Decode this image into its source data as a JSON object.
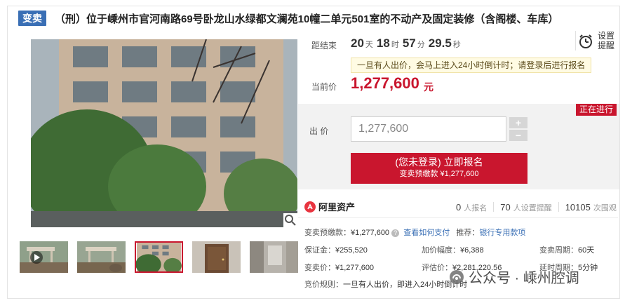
{
  "header": {
    "tag": "变卖",
    "title": "（刑）位于嵊州市官河南路69号卧龙山水绿都文澜苑10幢二单元501室的不动产及固定装修（含阁楼、车库）"
  },
  "countdown": {
    "label": "距结束",
    "days": "20",
    "days_unit": "天",
    "hours": "18",
    "hours_unit": "时",
    "minutes": "57",
    "minutes_unit": "分",
    "seconds": "29.5",
    "seconds_unit": "秒",
    "remind_label": "设置提醒"
  },
  "notice": "一旦有人出价，会马上进入24小时倒计时；请登录后进行报名",
  "current": {
    "label": "当前价",
    "price": "1,277,600",
    "unit": "元"
  },
  "bid": {
    "status": "正在进行",
    "label": "出 价",
    "value": "1,277,600",
    "plus": "+",
    "minus": "−",
    "button_main": "(您未登录) 立即报名",
    "button_sub": "变卖预缴款 ¥1,277,600"
  },
  "platform": {
    "name": "阿里资产",
    "signups": "0",
    "signups_label": "人报名",
    "reminders": "70",
    "reminders_label": "人设置提醒",
    "views": "10105",
    "views_label": "次围观"
  },
  "info": {
    "deposit_label": "变卖预缴款：",
    "deposit_value": "¥1,277,600",
    "pay_link": "查看如何支付",
    "recommend_label": "推荐：",
    "recommend_link": "银行专用款项",
    "guarantee_label": "保证金：",
    "guarantee_value": "¥255,520",
    "increment_label": "加价幅度：",
    "increment_value": "¥6,388",
    "period_label": "变卖周期：",
    "period_value": "60天",
    "sale_price_label": "变卖价：",
    "sale_price_value": "¥1,277,600",
    "appraisal_label": "评估价：",
    "appraisal_value": "¥2,281,220.56",
    "delay_label": "延时周期：",
    "delay_value": "5分钟",
    "rule_label": "竞价规则：",
    "rule_value": "一旦有人出价，即进入24小时倒计时"
  },
  "watermark": {
    "text": "公众号 · 嵊州腔调"
  }
}
